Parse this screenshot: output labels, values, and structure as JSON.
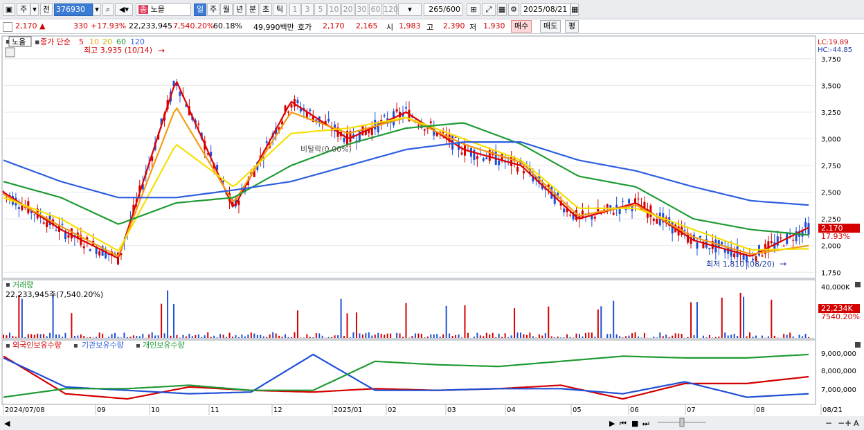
{
  "toolbar": {
    "period_week": "주",
    "prev": "전",
    "code": "376930",
    "name": "노을",
    "tf_day": "일",
    "tf_week": "주",
    "tf_month": "월",
    "tf_year": "년",
    "tf_min": "분",
    "tf_sec": "초",
    "tf_tick": "틱",
    "nums": [
      "1",
      "3",
      "5",
      "10",
      "20",
      "30",
      "60",
      "120"
    ],
    "count": "265",
    "count_total": "/600",
    "date": "2025/08/21"
  },
  "info": {
    "price": "2,170",
    "change_arrow": "▲",
    "change": "330",
    "change_pct": "+17.93%",
    "volume": "22,233,945",
    "vol_ratio": "7,540.20%",
    "turnover": "60.18%",
    "amount": "49,990백만",
    "quote_label": "호가",
    "ask": "2,170",
    "bid": "2,165",
    "open_label": "시",
    "open": "1,983",
    "high_label": "고",
    "high": "2,390",
    "low_label": "저",
    "low": "1,930",
    "buy": "매수",
    "sell": "매도",
    "eval": "평"
  },
  "legend": {
    "name": "노을",
    "ma_prefix": "종가 단순",
    "ma5": "5",
    "ma10": "10",
    "ma20": "20",
    "ma60": "60",
    "ma120": "120",
    "high_note": "최고 3,935 (10/14)",
    "low_note": "최저 1,810 (08/20)",
    "mid_note": "비탈락(0.00%)",
    "lc": "LC:19.89",
    "hc": "HC:-44.85",
    "price_tag": "2,170",
    "pct_tag": "17.93%"
  },
  "volume_panel": {
    "title": "거래량",
    "value": "22,233,945주(7,540.20%)",
    "max_label": "40,000K",
    "tag": "22,234K",
    "tag_pct": "7540.20%"
  },
  "holdings_panel": {
    "foreign": "외국인보유수량",
    "inst": "기관보유수량",
    "indiv": "개인보유수량",
    "axis": [
      "9,000,000",
      "8,000,000",
      "7,000,000"
    ]
  },
  "xaxis": [
    "2024/07/08",
    "09",
    "10",
    "11",
    "12",
    "2025/01",
    "02",
    "03",
    "04",
    "05",
    "06",
    "07",
    "08",
    "08/21"
  ],
  "colors": {
    "up": "#d40000",
    "down": "#1e4fd6",
    "ma5": "#e00000",
    "ma10": "#f39c12",
    "ma20": "#f5e000",
    "ma60": "#1f9a33",
    "ma120": "#2e5ee0"
  },
  "chart_data": {
    "type": "line",
    "title": "노을",
    "ylim": [
      1700,
      3950
    ],
    "yticks": [
      "3,750",
      "3,500",
      "3,250",
      "3,000",
      "2,750",
      "2,500",
      "2,250",
      "2,000",
      "1,750"
    ],
    "x": [
      "2024/07",
      "2024/08",
      "2024/09",
      "2024/10",
      "2024/11",
      "2024/12",
      "2025/01",
      "2025/02",
      "2025/03",
      "2025/04",
      "2025/05",
      "2025/06",
      "2025/07",
      "2025/08",
      "2025/08/21"
    ],
    "series": [
      {
        "name": "5",
        "values": [
          2500,
          2150,
          1880,
          3550,
          2350,
          3350,
          3000,
          3250,
          2900,
          2750,
          2250,
          2400,
          2050,
          1900,
          2170
        ]
      },
      {
        "name": "10",
        "values": [
          2480,
          2180,
          1900,
          3300,
          2400,
          3250,
          3050,
          3200,
          2950,
          2780,
          2280,
          2380,
          2080,
          1920,
          2000
        ]
      },
      {
        "name": "20",
        "values": [
          2450,
          2250,
          1950,
          2950,
          2550,
          3050,
          3100,
          3200,
          3000,
          2800,
          2350,
          2350,
          2150,
          1960,
          1970
        ]
      },
      {
        "name": "60",
        "values": [
          2600,
          2450,
          2200,
          2400,
          2450,
          2750,
          2950,
          3100,
          3150,
          2950,
          2650,
          2550,
          2250,
          2150,
          2100
        ]
      },
      {
        "name": "120",
        "values": [
          2800,
          2600,
          2450,
          2450,
          2520,
          2600,
          2750,
          2900,
          2970,
          2970,
          2800,
          2700,
          2550,
          2420,
          2380
        ]
      }
    ],
    "volume_max": "40,000K",
    "holdings": {
      "x": [
        "2024/07",
        "2024/08",
        "2024/09",
        "2024/10",
        "2024/11",
        "2024/12",
        "2025/01",
        "2025/02",
        "2025/03",
        "2025/04",
        "2025/05",
        "2025/06",
        "2025/07",
        "2025/08"
      ],
      "series": [
        {
          "name": "외국인보유수량",
          "values": [
            9100000,
            6900000,
            6600000,
            7300000,
            7100000,
            7000000,
            7200000,
            7100000,
            7200000,
            7400000,
            6600000,
            7500000,
            7500000,
            7900000
          ]
        },
        {
          "name": "기관보유수량",
          "values": [
            9000000,
            7300000,
            7100000,
            6900000,
            7000000,
            9200000,
            7100000,
            7100000,
            7200000,
            7200000,
            6900000,
            7600000,
            6700000,
            6900000
          ]
        },
        {
          "name": "개인보유수량",
          "values": [
            6700000,
            7200000,
            7200000,
            7400000,
            7100000,
            7100000,
            8800000,
            8600000,
            8500000,
            8800000,
            9100000,
            9000000,
            9000000,
            9200000
          ]
        }
      ]
    }
  }
}
